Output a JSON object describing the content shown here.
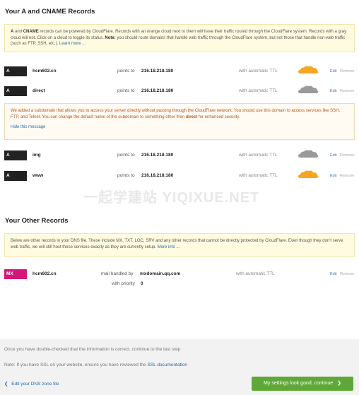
{
  "section_a_title": "Your A and CNAME Records",
  "note_a": {
    "part1": "A",
    "and": " and ",
    "part2": "CNAME",
    "rest1": " records can be powered by CloudFlare. Records with an orange cloud next to them will have their traffic routed through the CloudFlare system. Records with a gray cloud will not. Click on a cloud to toggle its status. ",
    "note_label": "Note:",
    "rest2": " you should route domains that handle web traffic through the CloudFlare system, but not those that handle non-web traffic (such as FTP, SSH, etc.). ",
    "learn_more": "Learn more ..."
  },
  "records_a": [
    {
      "type": "A",
      "name": "hcm602.cn",
      "points_to": "points to",
      "ip": "216.18.218.180",
      "ttl": "with automatic TTL",
      "cloud": "orange",
      "edit": "Edit",
      "remove": "Remove"
    },
    {
      "type": "A",
      "name": "direct",
      "points_to": "points to",
      "ip": "216.18.218.180",
      "ttl": "with automatic TTL",
      "cloud": "gray",
      "edit": "Edit",
      "remove": "Remove"
    },
    {
      "type": "A",
      "name": "img",
      "points_to": "points to",
      "ip": "216.18.218.180",
      "ttl": "with automatic TTL",
      "cloud": "gray",
      "edit": "Edit",
      "remove": "Remove"
    },
    {
      "type": "A",
      "name": "www",
      "points_to": "points to",
      "ip": "216.18.218.180",
      "ttl": "with automatic TTL",
      "cloud": "orange",
      "edit": "Edit",
      "remove": "Remove"
    }
  ],
  "direct_note": {
    "text1": "We added a subdomain that allows you to access your server directly without passing through the CloudFlare network. You should use this domain to access services like SSH, FTP, and Telnet. You can change the default name of the subdomain to something other than ",
    "bold": "direct",
    "text2": " for enhanced security.",
    "hide": "Hide this message"
  },
  "watermark": "一起学建站 YIQIXUE.NET",
  "section_other_title": "Your Other Records",
  "note_other": {
    "text": "Below are other records in your DNS file. These include MX, TXT, LOC, SRV and any other records that cannot be directly protected by CloudFlare. Even though they don't serve web traffic, we will still host these services exactly as they are currently setup. ",
    "more": "More info ..."
  },
  "record_mx": {
    "type": "MX",
    "name": "hcm602.cn",
    "handled": "mail handled by",
    "server": "mxdomain.qq.com",
    "priority_label": "with priority",
    "priority": "0",
    "ttl": "with automatic TTL",
    "edit": "Edit",
    "remove": "Remove"
  },
  "footer": {
    "line1": "Once you have double-checked that the information is correct, continue to the last step",
    "note_prefix": "Note: If you have SSL on your website, ensure you have reviewed the ",
    "ssl_link": "SSL documentation",
    "back": "Edit your DNS zone file",
    "continue": "My settings look good, continue"
  },
  "colors": {
    "orange_cloud": "#f5a623",
    "gray_cloud": "#9a9a9a",
    "mx_badge": "#d4187a",
    "continue_button": "#5fa838"
  }
}
